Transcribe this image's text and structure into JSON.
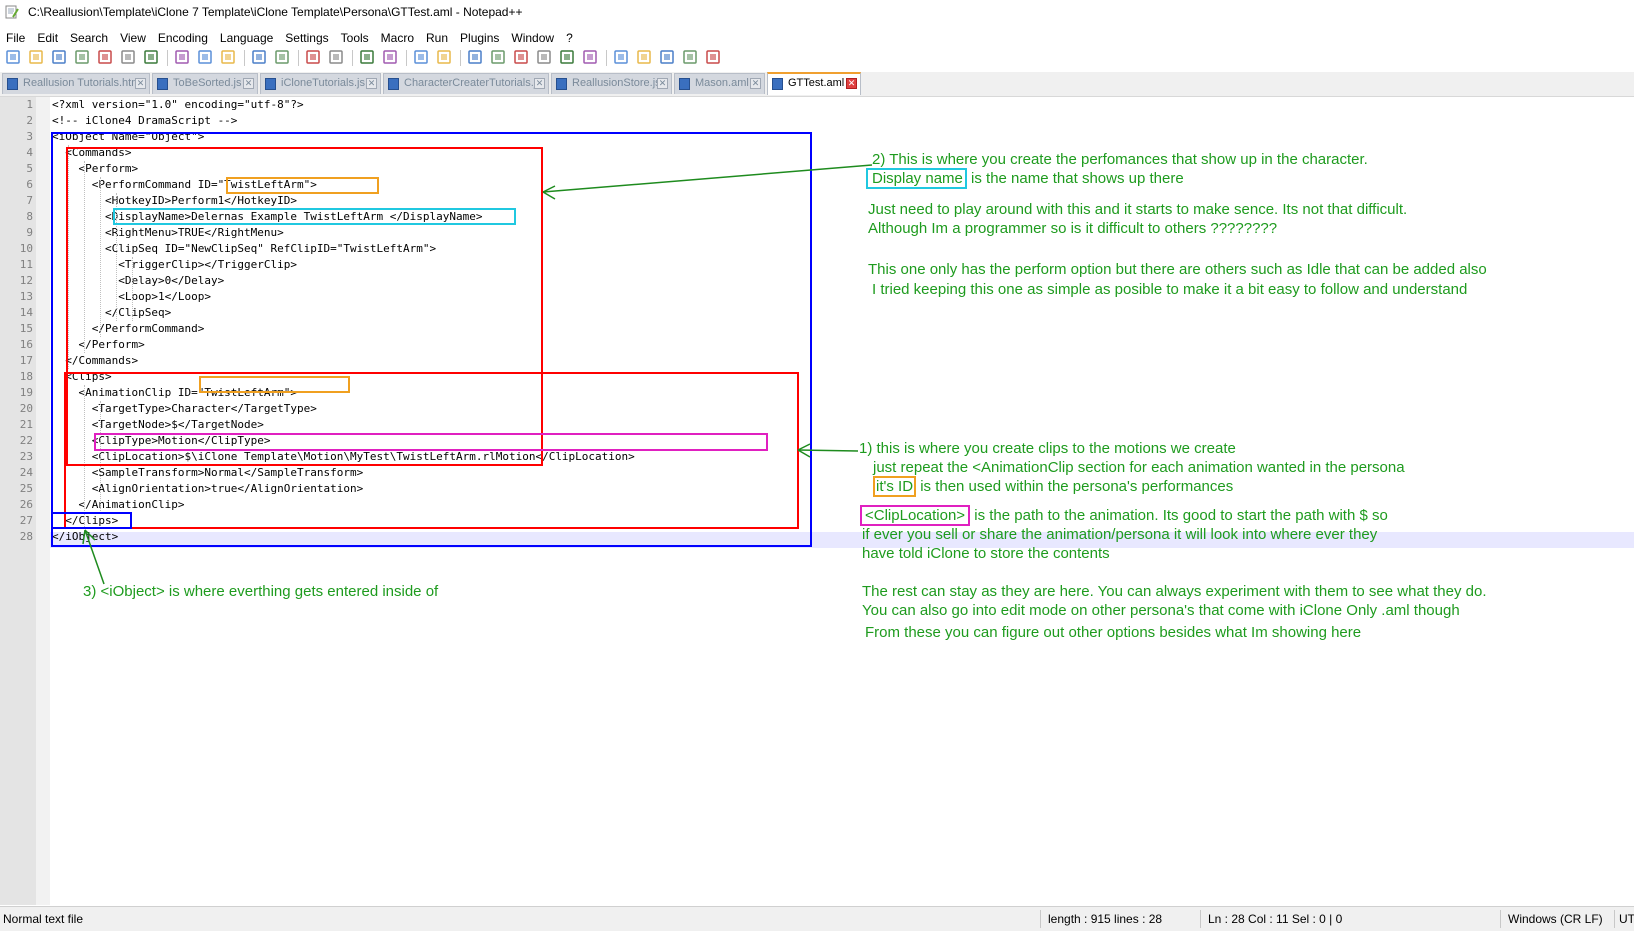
{
  "window": {
    "title": "C:\\Reallusion\\Template\\iClone 7 Template\\iClone Template\\Persona\\GTTest.aml - Notepad++"
  },
  "menu": [
    "File",
    "Edit",
    "Search",
    "View",
    "Encoding",
    "Language",
    "Settings",
    "Tools",
    "Macro",
    "Run",
    "Plugins",
    "Window",
    "?"
  ],
  "toolbar_icons": [
    "new-file-icon",
    "open-file-icon",
    "save-icon",
    "save-all-icon",
    "close-icon",
    "close-all-icon",
    "print-icon",
    "cut-icon",
    "copy-icon",
    "paste-icon",
    "undo-icon",
    "redo-icon",
    "find-icon",
    "replace-icon",
    "zoom-in-icon",
    "zoom-out-icon",
    "sync-vertical-icon",
    "sync-horizontal-icon",
    "word-wrap-icon",
    "show-all-chars-icon",
    "indent-guide-icon",
    "user-defined-language-icon",
    "doc-map-icon",
    "function-list-icon",
    "folder-workspace-icon",
    "monitoring-icon",
    "record-macro-icon",
    "stop-record-icon",
    "play-macro-icon",
    "run-macro-multiple-icon",
    "save-macro-icon"
  ],
  "tabs": [
    {
      "label": "Reallusion Tutorials.html",
      "active": false
    },
    {
      "label": "ToBeSorted.js",
      "active": false
    },
    {
      "label": "iCloneTutorials.js",
      "active": false
    },
    {
      "label": "CharacterCreaterTutorials.js",
      "active": false
    },
    {
      "label": "ReallusionStore.js",
      "active": false
    },
    {
      "label": "Mason.aml",
      "active": false
    },
    {
      "label": "GTTest.aml",
      "active": true
    }
  ],
  "code_lines": [
    "<?xml version=\"1.0\" encoding=\"utf-8\"?>",
    "<!-- iClone4 DramaScript -->",
    "<iObject Name=\"Object\">",
    "  <Commands>",
    "    <Perform>",
    "      <PerformCommand ID=\"TwistLeftArm\">",
    "        <HotkeyID>Perform1</HotkeyID>",
    "        <DisplayName>Delernas Example TwistLeftArm </DisplayName>",
    "        <RightMenu>TRUE</RightMenu>",
    "        <ClipSeq ID=\"NewClipSeq\" RefClipID=\"TwistLeftArm\">",
    "          <TriggerClip></TriggerClip>",
    "          <Delay>0</Delay>",
    "          <Loop>1</Loop>",
    "        </ClipSeq>",
    "      </PerformCommand>",
    "    </Perform>",
    "  </Commands>",
    "  <Clips>",
    "    <AnimationClip ID=\"TwistLeftArm\">",
    "      <TargetType>Character</TargetType>",
    "      <TargetNode>$</TargetNode>",
    "      <ClipType>Motion</ClipType>",
    "      <ClipLocation>$\\iClone Template\\Motion\\MyTest\\TwistLeftArm.rlMotion</ClipLocation>",
    "      <SampleTransform>Normal</SampleTransform>",
    "      <AlignOrientation>true</AlignOrientation>",
    "    </AnimationClip>",
    "  </Clips>",
    "</iObject>"
  ],
  "notes": {
    "note2_line1": "2) This is where you create the perfomances that show up in the character.",
    "note2_boxed": "Display name",
    "note2_line2_rest": " is the name that shows up there",
    "note2_p2_line1": "Just need to play around with this and it starts to make sence. Its not that difficult.",
    "note2_p2_line2": "Although Im a programmer so is it difficult to others ????????",
    "note2_p3_line1": "This one only has the perform option but there are others such as Idle that can be added also",
    "note2_p3_line2": "I tried keeping this one as simple as posible to make it a bit easy to follow and understand",
    "note1_line1": "1) this is where you create clips to the motions we create",
    "note1_line2": "just repeat the <AnimationClip section for each animation wanted in the persona",
    "note1_boxed": "it's ID",
    "note1_line3_rest": " is then used within the persona's performances",
    "clip_boxed": "<ClipLocation>",
    "clip_line1_rest": " is the path to the animation. Its good to start the path with $ so",
    "clip_line2": "if ever you sell or share the animation/persona it will look into where ever they",
    "clip_line3": "have told iClone to store the contents",
    "rest_line1": "The rest can stay as they are here. You can always experiment with them to see what they do.",
    "rest_line2": "You can also go into edit mode on other persona's that come with iClone   Only .aml though",
    "rest_line3": "From these you can figure out other options besides what Im showing here",
    "note3": "3) <iObject> is where everthing gets entered inside of"
  },
  "status": {
    "file_type": "Normal text file",
    "length_lines": "length : 915    lines : 28",
    "position": "Ln : 28    Col : 11    Sel : 0 | 0",
    "eol": "Windows (CR LF)",
    "encoding": "UT"
  },
  "colors": {
    "note_green": "#1e9b1e",
    "box_blue": "#0000ff",
    "box_red": "#ff0000",
    "box_orange": "#f0a020",
    "box_cyan": "#20c8e0",
    "box_magenta": "#e020c0"
  }
}
